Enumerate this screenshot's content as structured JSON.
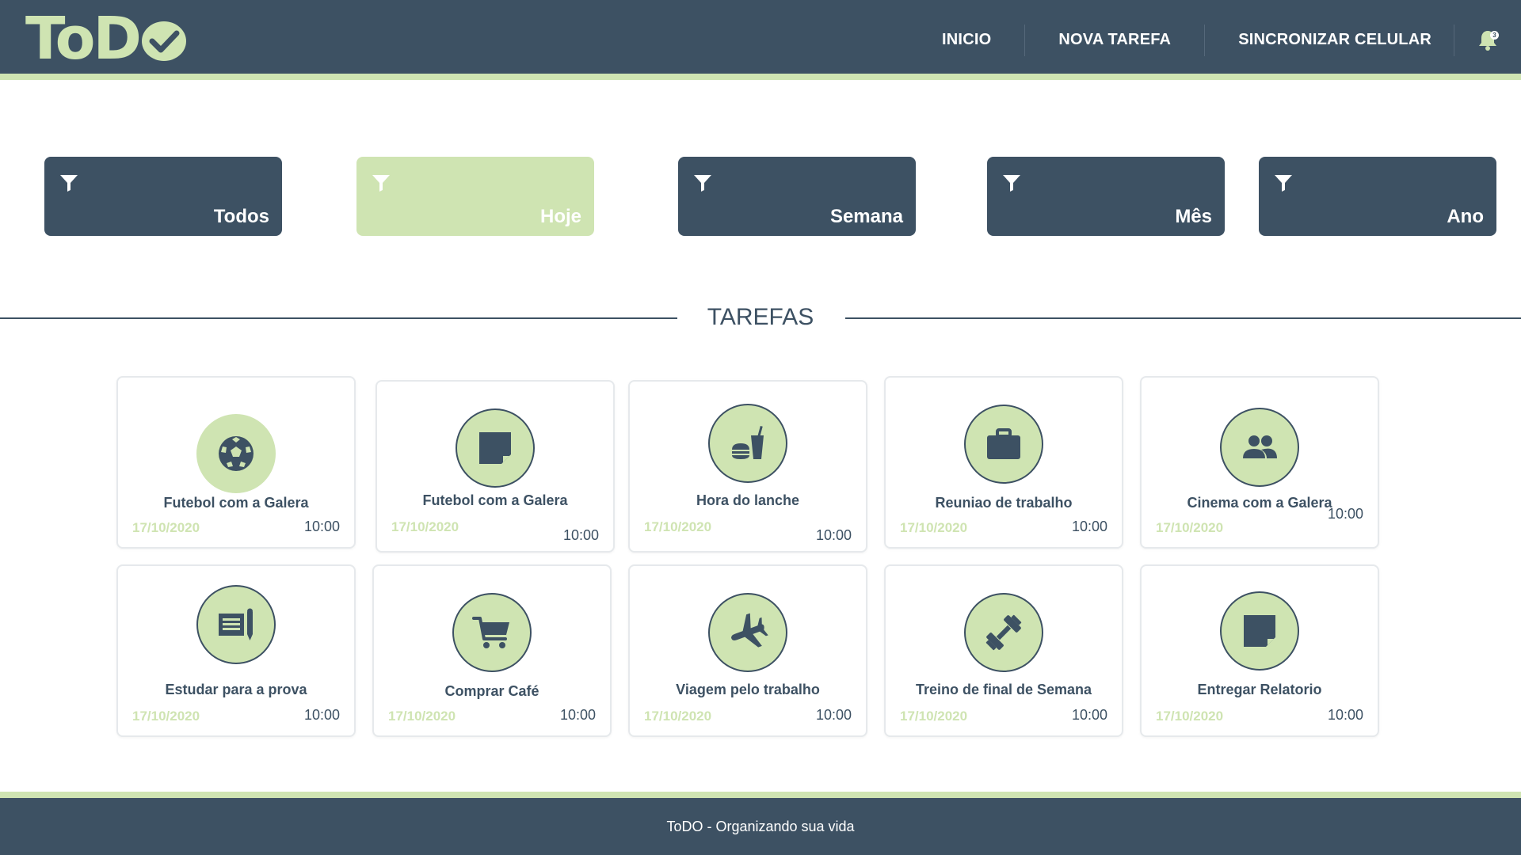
{
  "header": {
    "logo_text": "ToD",
    "nav": [
      "INICIO",
      "NOVA TAREFA",
      "SINCRONIZAR CELULAR"
    ],
    "notification_count": "3",
    "colors": {
      "primary": "#3d5163",
      "accent": "#cfe4b2"
    }
  },
  "filters": [
    {
      "label": "Todos",
      "active": false,
      "icon": "filter-icon"
    },
    {
      "label": "Hoje",
      "active": true,
      "icon": "filter-icon"
    },
    {
      "label": "Semana",
      "active": false,
      "icon": "filter-icon"
    },
    {
      "label": "Mês",
      "active": false,
      "icon": "filter-icon"
    },
    {
      "label": "Ano",
      "active": false,
      "icon": "filter-icon"
    }
  ],
  "section": {
    "title": "TAREFAS"
  },
  "tasks": [
    {
      "title": "Futebol com a Galera",
      "date": "17/10/2020",
      "time": "10:00",
      "icon": "soccer-ball-icon"
    },
    {
      "title": "Futebol com a Galera",
      "date": "17/10/2020",
      "time": "10:00",
      "icon": "sticky-note-icon"
    },
    {
      "title": "Hora do lanche",
      "date": "17/10/2020",
      "time": "10:00",
      "icon": "fast-food-icon"
    },
    {
      "title": "Reuniao de trabalho",
      "date": "17/10/2020",
      "time": "10:00",
      "icon": "briefcase-icon"
    },
    {
      "title": "Cinema com a Galera",
      "date": "17/10/2020",
      "time": "10:00",
      "icon": "people-icon"
    },
    {
      "title": "Estudar para a prova",
      "date": "17/10/2020",
      "time": "10:00",
      "icon": "notes-pencil-icon"
    },
    {
      "title": "Comprar Café",
      "date": "17/10/2020",
      "time": "10:00",
      "icon": "shopping-cart-icon"
    },
    {
      "title": "Viagem pelo trabalho",
      "date": "17/10/2020",
      "time": "10:00",
      "icon": "airplane-icon"
    },
    {
      "title": "Treino de final de Semana",
      "date": "17/10/2020",
      "time": "10:00",
      "icon": "dumbbell-icon"
    },
    {
      "title": "Entregar Relatorio",
      "date": "17/10/2020",
      "time": "10:00",
      "icon": "sticky-note-icon"
    }
  ],
  "footer": {
    "text": "ToDO - Organizando sua vida"
  }
}
